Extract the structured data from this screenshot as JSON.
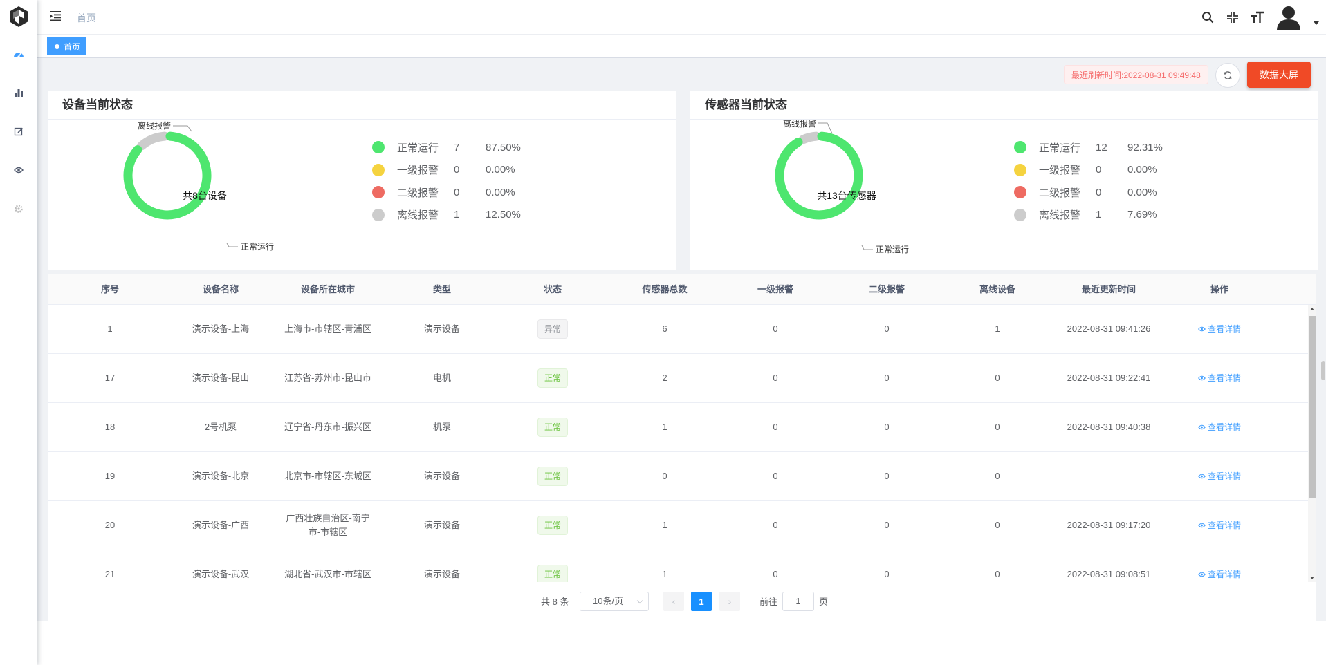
{
  "header": {
    "breadcrumb": "首页"
  },
  "tags": {
    "active": "首页"
  },
  "toolbar": {
    "refresh_time": "最近刷新时间:2022-08-31 09:49:48",
    "big_screen_label": "数据大屏"
  },
  "device_card": {
    "title": "设备当前状态",
    "center_label": "共8台设备",
    "callout_offline": "离线报警",
    "callout_normal": "正常运行",
    "legend": [
      {
        "name": "正常运行",
        "count": "7",
        "percent": "87.50%",
        "color": "#4ee66f"
      },
      {
        "name": "一级报警",
        "count": "0",
        "percent": "0.00%",
        "color": "#f5d33f"
      },
      {
        "name": "二级报警",
        "count": "0",
        "percent": "0.00%",
        "color": "#ee6b62"
      },
      {
        "name": "离线报警",
        "count": "1",
        "percent": "12.50%",
        "color": "#cccccc"
      }
    ]
  },
  "sensor_card": {
    "title": "传感器当前状态",
    "center_label": "共13台传感器",
    "callout_offline": "离线报警",
    "callout_normal": "正常运行",
    "legend": [
      {
        "name": "正常运行",
        "count": "12",
        "percent": "92.31%",
        "color": "#4ee66f"
      },
      {
        "name": "一级报警",
        "count": "0",
        "percent": "0.00%",
        "color": "#f5d33f"
      },
      {
        "name": "二级报警",
        "count": "0",
        "percent": "0.00%",
        "color": "#ee6b62"
      },
      {
        "name": "离线报警",
        "count": "1",
        "percent": "7.69%",
        "color": "#cccccc"
      }
    ]
  },
  "table": {
    "columns": [
      "序号",
      "设备名称",
      "设备所在城市",
      "类型",
      "状态",
      "传感器总数",
      "一级报警",
      "二级报警",
      "离线设备",
      "最近更新时间",
      "操作"
    ],
    "detail_label": "查看详情",
    "rows": [
      {
        "id": "1",
        "name": "演示设备-上海",
        "city": "上海市-市辖区-青浦区",
        "type": "演示设备",
        "status": "异常",
        "status_ok": false,
        "sensors": "6",
        "l1": "0",
        "l2": "0",
        "offline": "1",
        "updated": "2022-08-31 09:41:26"
      },
      {
        "id": "17",
        "name": "演示设备-昆山",
        "city": "江苏省-苏州市-昆山市",
        "type": "电机",
        "status": "正常",
        "status_ok": true,
        "sensors": "2",
        "l1": "0",
        "l2": "0",
        "offline": "0",
        "updated": "2022-08-31 09:22:41"
      },
      {
        "id": "18",
        "name": "2号机泵",
        "city": "辽宁省-丹东市-振兴区",
        "type": "机泵",
        "status": "正常",
        "status_ok": true,
        "sensors": "1",
        "l1": "0",
        "l2": "0",
        "offline": "0",
        "updated": "2022-08-31 09:40:38"
      },
      {
        "id": "19",
        "name": "演示设备-北京",
        "city": "北京市-市辖区-东城区",
        "type": "演示设备",
        "status": "正常",
        "status_ok": true,
        "sensors": "0",
        "l1": "0",
        "l2": "0",
        "offline": "0",
        "updated": ""
      },
      {
        "id": "20",
        "name": "演示设备-广西",
        "city": "广西壮族自治区-南宁市-市辖区",
        "type": "演示设备",
        "status": "正常",
        "status_ok": true,
        "sensors": "1",
        "l1": "0",
        "l2": "0",
        "offline": "0",
        "updated": "2022-08-31 09:17:20"
      },
      {
        "id": "21",
        "name": "演示设备-武汉",
        "city": "湖北省-武汉市-市辖区",
        "type": "演示设备",
        "status": "正常",
        "status_ok": true,
        "sensors": "1",
        "l1": "0",
        "l2": "0",
        "offline": "0",
        "updated": "2022-08-31 09:08:51"
      }
    ]
  },
  "pagination": {
    "total": "共 8 条",
    "page_size": "10条/页",
    "current_page": "1",
    "goto_label": "前往",
    "goto_value": "1",
    "goto_unit": "页"
  },
  "colors": {
    "primary": "#409eff",
    "danger_button": "#f04a26",
    "normal": "#4ee66f",
    "offline": "#cccccc"
  },
  "icons": {
    "sidebar": [
      "dashboard-icon",
      "bar-chart-icon",
      "edit-icon",
      "eye-icon",
      "gear-icon"
    ],
    "topbar": [
      "search-icon",
      "exit-fullscreen-icon",
      "font-size-icon",
      "user-avatar-icon"
    ]
  }
}
